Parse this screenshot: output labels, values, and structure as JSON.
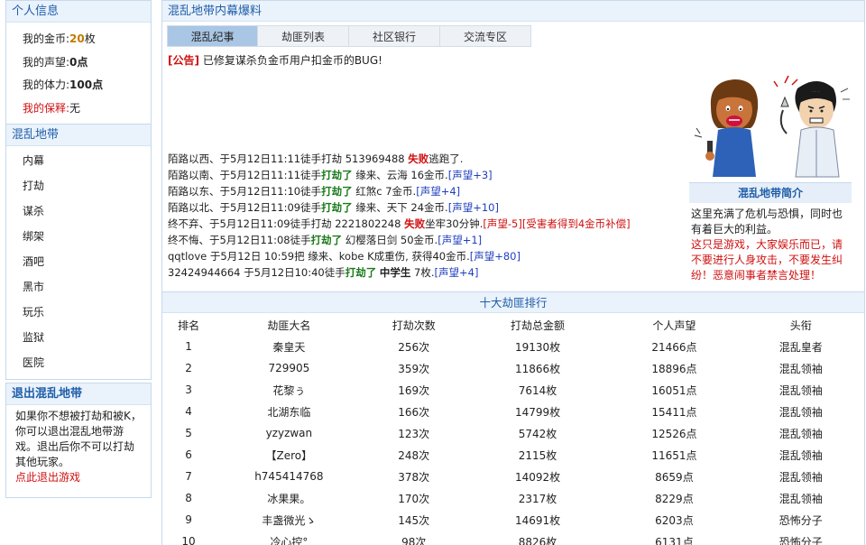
{
  "profile": {
    "header": "个人信息",
    "gold_label": "我的金币:",
    "gold_value": "20",
    "gold_unit": "枚",
    "rep_label": "我的声望:",
    "rep_value": "0点",
    "stamina_label": "我的体力:",
    "stamina_value": "100点",
    "bail_label": "我的保释:",
    "bail_value": "无"
  },
  "zone_nav": {
    "header": "混乱地带",
    "items": [
      "内幕",
      "打劫",
      "谋杀",
      "绑架",
      "酒吧",
      "黑市",
      "玩乐",
      "监狱",
      "医院"
    ]
  },
  "exit": {
    "header": "退出混乱地带",
    "text": "如果你不想被打劫和被K，你可以退出混乱地带游戏。退出后你不可以打劫其他玩家。",
    "link": "点此退出游戏"
  },
  "main": {
    "header": "混乱地带内幕爆料",
    "tabs": [
      "混乱纪事",
      "劫匪列表",
      "社区银行",
      "交流专区"
    ],
    "notice_tag": "[公告]",
    "notice_text": "已修复谋杀负金币用户扣金币的BUG!"
  },
  "events": [
    [
      {
        "t": "陌路以西、于5月12日11:11徒手打劫 513969488 "
      },
      {
        "t": "失败",
        "c": "fail"
      },
      {
        "t": "逃跑了."
      }
    ],
    [
      {
        "t": "陌路以南、于5月12日11:11徒手"
      },
      {
        "t": "打劫了",
        "c": "rob"
      },
      {
        "t": " 缘来、云海 16金币."
      },
      {
        "t": "[声望+3]",
        "c": "rep"
      }
    ],
    [
      {
        "t": "陌路以东、于5月12日11:10徒手"
      },
      {
        "t": "打劫了",
        "c": "rob"
      },
      {
        "t": " 红煞c 7金币."
      },
      {
        "t": "[声望+4]",
        "c": "rep"
      }
    ],
    [
      {
        "t": "陌路以北、于5月12日11:09徒手"
      },
      {
        "t": "打劫了",
        "c": "rob"
      },
      {
        "t": " 缘来、天下 24金币."
      },
      {
        "t": "[声望+10]",
        "c": "rep"
      }
    ],
    [
      {
        "t": "终不弃、于5月12日11:09徒手打劫 2221802248 "
      },
      {
        "t": "失败",
        "c": "fail"
      },
      {
        "t": "坐牢30分钟."
      },
      {
        "t": "[声望-5]",
        "c": "redtxt"
      },
      {
        "t": "[受害者得到4金币补偿]",
        "c": "redtxt"
      }
    ],
    [
      {
        "t": "终不悔、于5月12日11:08徒手"
      },
      {
        "t": "打劫了",
        "c": "rob"
      },
      {
        "t": " 幻樱落日剑 50金币."
      },
      {
        "t": "[声望+1]",
        "c": "rep"
      }
    ],
    [
      {
        "t": "qqtlove 于5月12日 10:59把 缘来、kobe K成重伤, 获得40金币."
      },
      {
        "t": "[声望+80]",
        "c": "rep"
      }
    ],
    [
      {
        "t": "32424944664 于5月12日10:40徒手"
      },
      {
        "t": "打劫了",
        "c": "rob"
      },
      {
        "t": " "
      },
      {
        "t": "中学生",
        "c": "bk"
      },
      {
        "t": " 7枚."
      },
      {
        "t": "[声望+4]",
        "c": "rep"
      }
    ]
  ],
  "intro": {
    "title": "混乱地带简介",
    "text": "这里充满了危机与恐惧，同时也有着巨大的利益。",
    "warning": "这只是游戏，大家娱乐而已，请不要进行人身攻击，不要发生纠纷！恶意闹事者禁言处理！"
  },
  "ranking": {
    "title": "十大劫匪排行",
    "headers": [
      "排名",
      "劫匪大名",
      "打劫次数",
      "打劫总金额",
      "个人声望",
      "头衔"
    ],
    "rows": [
      [
        "1",
        "秦皇天",
        "256次",
        "19130枚",
        "21466点",
        "混乱皇者"
      ],
      [
        "2",
        "729905",
        "359次",
        "11866枚",
        "18896点",
        "混乱领袖"
      ],
      [
        "3",
        "花黎ぅ",
        "169次",
        "7614枚",
        "16051点",
        "混乱领袖"
      ],
      [
        "4",
        "北湖东临",
        "166次",
        "14799枚",
        "15411点",
        "混乱领袖"
      ],
      [
        "5",
        "yzyzwan",
        "123次",
        "5742枚",
        "12526点",
        "混乱领袖"
      ],
      [
        "6",
        "【Zero】",
        "248次",
        "2115枚",
        "11651点",
        "混乱领袖"
      ],
      [
        "7",
        "h745414768",
        "378次",
        "14092枚",
        "8659点",
        "混乱领袖"
      ],
      [
        "8",
        "冰果果。",
        "170次",
        "2317枚",
        "8229点",
        "混乱领袖"
      ],
      [
        "9",
        "丰盏微光ゝ",
        "145次",
        "14691枚",
        "6203点",
        "恐怖分子"
      ],
      [
        "10",
        "冷心控°",
        "98次",
        "8826枚",
        "6131点",
        "恐怖分子"
      ]
    ]
  }
}
